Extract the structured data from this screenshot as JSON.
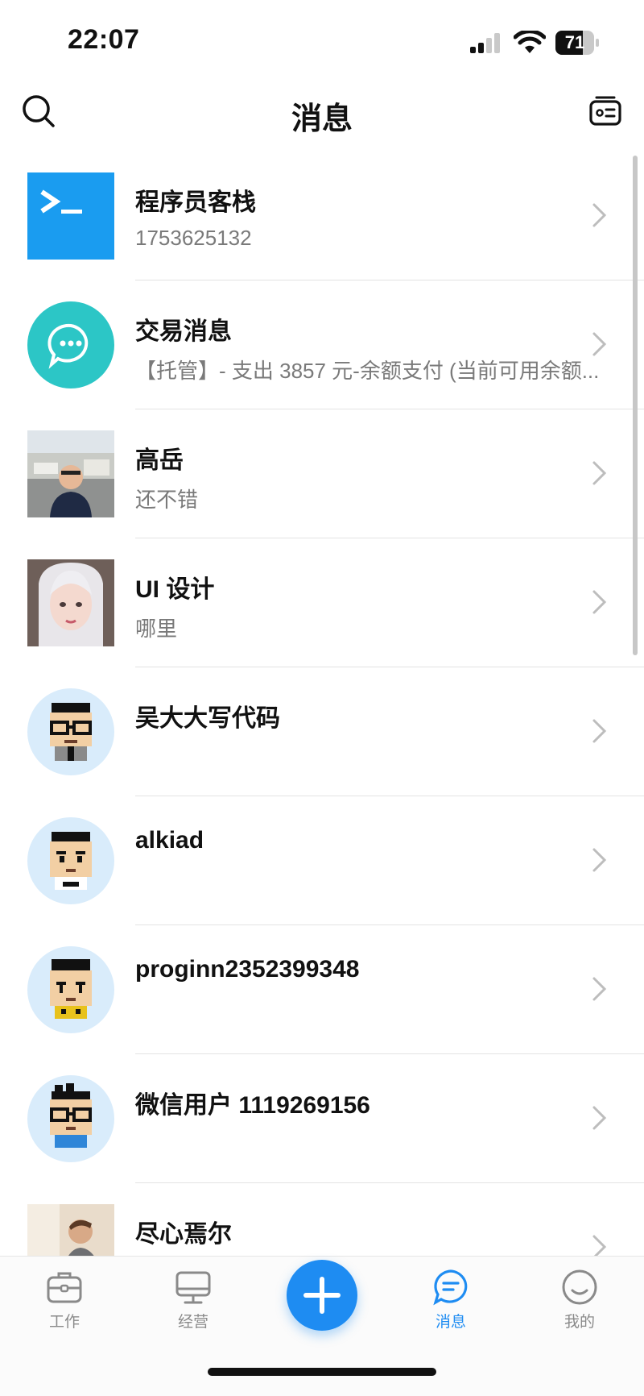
{
  "status_bar": {
    "time": "22:07",
    "battery": "71",
    "battery_level": 0.71
  },
  "header": {
    "title": "消息",
    "left_icon": "search-icon",
    "right_icon": "contact-card-icon"
  },
  "messages": [
    {
      "name": "程序员客栈",
      "subtitle": "1753625132",
      "avatar": "terminal-logo"
    },
    {
      "name": "交易消息",
      "subtitle": "【托管】- 支出 3857 元-余额支付 (当前可用余额...",
      "avatar": "chat-bubble-logo"
    },
    {
      "name": "高岳",
      "subtitle": "还不错",
      "avatar": "photo"
    },
    {
      "name": "UI 设计",
      "subtitle": "哪里",
      "avatar": "photo"
    },
    {
      "name": "吴大大写代码",
      "subtitle": "",
      "avatar": "pixel-avatar-glasses"
    },
    {
      "name": "alkiad",
      "subtitle": "",
      "avatar": "pixel-avatar"
    },
    {
      "name": "proginn2352399348",
      "subtitle": "",
      "avatar": "pixel-avatar"
    },
    {
      "name": "微信用户 1119269156",
      "subtitle": "",
      "avatar": "pixel-avatar-glasses"
    },
    {
      "name": "尽心焉尔",
      "subtitle": "",
      "avatar": "photo"
    }
  ],
  "tabs": [
    {
      "label": "工作",
      "icon": "briefcase-icon",
      "active": false
    },
    {
      "label": "经营",
      "icon": "monitor-icon",
      "active": false
    },
    {
      "label": "",
      "icon": "plus-icon",
      "active": false
    },
    {
      "label": "消息",
      "icon": "message-icon",
      "active": true
    },
    {
      "label": "我的",
      "icon": "smile-icon",
      "active": false
    }
  ],
  "colors": {
    "accent": "#1e8cf2",
    "teal": "#2cc6c6",
    "terminal_blue": "#1a9cf0"
  }
}
